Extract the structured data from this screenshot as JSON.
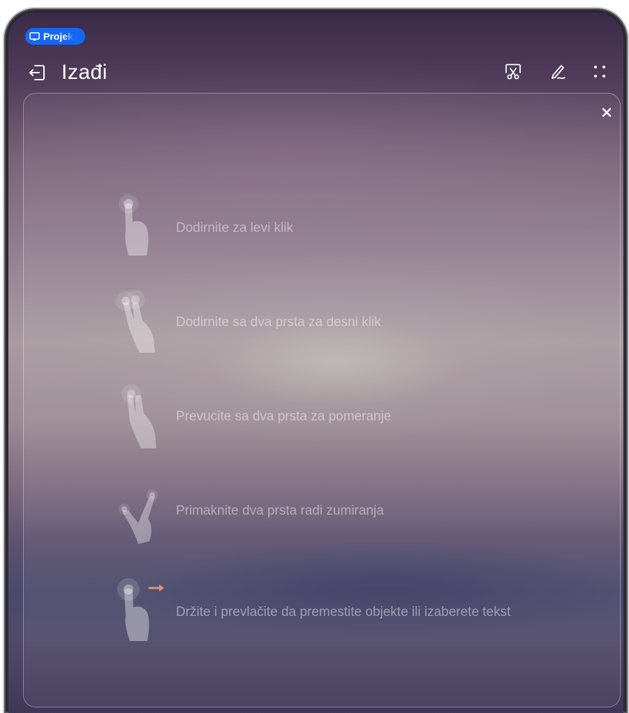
{
  "status_chip": {
    "label": "Projek",
    "icon": "projection-icon",
    "color": "#1668f2"
  },
  "header": {
    "exit_label": "Izađi",
    "exit_icon": "exit-icon",
    "toolbar_icons": [
      "screenshot-scissors-icon",
      "pen-annotate-icon",
      "more-grid-icon"
    ]
  },
  "guide": {
    "close_icon": "close-icon",
    "gestures": [
      {
        "text": "Dodirnite za levi klik",
        "icon": "single-tap-icon"
      },
      {
        "text": "Dodirnite sa dva prsta za desni klik",
        "icon": "two-finger-tap-icon"
      },
      {
        "text": "Prevucite sa dva prsta za pomeranje",
        "icon": "two-finger-swipe-icon"
      },
      {
        "text": "Primaknite dva prsta radi zumiranja",
        "icon": "pinch-zoom-icon"
      },
      {
        "text": "Držite i prevlačite da premestite objekte ili izaberete tekst",
        "icon": "press-drag-icon"
      }
    ]
  }
}
